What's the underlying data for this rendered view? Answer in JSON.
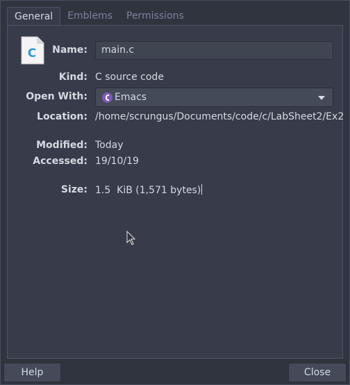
{
  "tabs": [
    {
      "label": "General",
      "active": true
    },
    {
      "label": "Emblems",
      "active": false
    },
    {
      "label": "Permissions",
      "active": false
    }
  ],
  "file": {
    "icon": "c-source-file-icon",
    "icon_letter": "C"
  },
  "fields": {
    "name": {
      "label": "Name:",
      "value": "main.c"
    },
    "kind": {
      "label": "Kind:",
      "value": "C source code"
    },
    "open_with": {
      "label": "Open With:",
      "value": "Emacs",
      "icon": "emacs-icon"
    },
    "location": {
      "label": "Location:",
      "value": "/home/scrungus/Documents/code/c/LabSheet2/Ex2"
    },
    "modified": {
      "label": "Modified:",
      "value": "Today"
    },
    "accessed": {
      "label": "Accessed:",
      "value": "19/10/19"
    },
    "size": {
      "label": "Size:",
      "value": "1.5  KiB (1,571 bytes)"
    }
  },
  "buttons": {
    "help": "Help",
    "close": "Close"
  },
  "colors": {
    "background": "#2f343f",
    "panel": "#383c4a",
    "text": "#d3dae3",
    "inactive_tab": "#7c8394",
    "emacs": "#7f5ab6",
    "file_icon_letter": "#2d9ad8"
  }
}
